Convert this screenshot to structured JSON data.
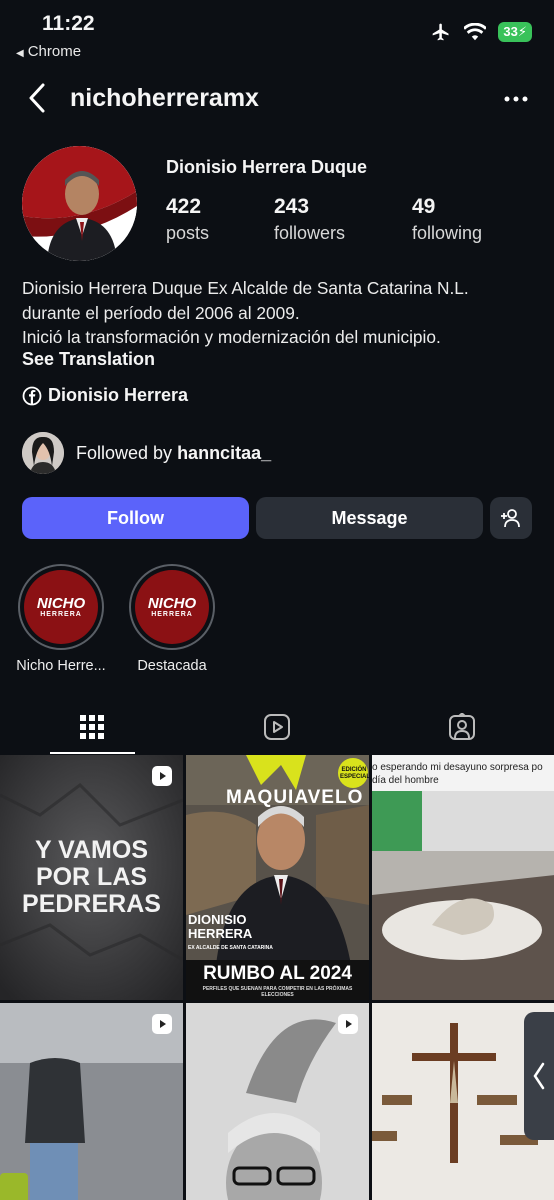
{
  "status_bar": {
    "time": "11:22",
    "back_app": "Chrome",
    "battery": "33"
  },
  "header": {
    "username": "nichoherreramx"
  },
  "profile": {
    "full_name": "Dionisio Herrera Duque",
    "stats": [
      {
        "value": "422",
        "label": "posts"
      },
      {
        "value": "243",
        "label": "followers"
      },
      {
        "value": "49",
        "label": "following"
      }
    ],
    "bio_lines": [
      "Dionisio Herrera Duque Ex Alcalde de Santa Catarina N.L.",
      "durante el período del 2006 al 2009.",
      "Inició la transformación y modernización del municipio."
    ],
    "see_translation": "See Translation",
    "facebook_link": "Dionisio Herrera",
    "followed_by_prefix": "Followed by",
    "followed_by_user": "hanncitaa_"
  },
  "actions": {
    "follow": "Follow",
    "message": "Message"
  },
  "highlights": [
    {
      "label": "Nicho Herre...",
      "logo": "NICHO",
      "sub": "HERRERA"
    },
    {
      "label": "Destacada",
      "logo": "NICHO",
      "sub": "HERRERA"
    }
  ],
  "posts": {
    "post1_text": [
      "Y VAMOS",
      "POR LAS",
      "PEDRERAS"
    ],
    "post2": {
      "top": "MAQUIAVELO",
      "badge": "EDICIÓN ESPECIAL",
      "name1": "DIONISIO",
      "name2": "HERRERA",
      "subtitle": "EX ALCALDE DE SANTA CATARINA",
      "banner": "RUMBO AL 2024",
      "banner_sub": "PERFILES QUE SUENAN PARA COMPETIR EN LAS PRÓXIMAS ELECCIONES"
    },
    "post3_caption": "o esperando mi desayuno sorpresa po día del hombre"
  },
  "colors": {
    "background": "#0c0f14",
    "follow_button": "#5b63fa",
    "secondary_button": "#2a2f37",
    "highlight_red": "#8b1114"
  }
}
